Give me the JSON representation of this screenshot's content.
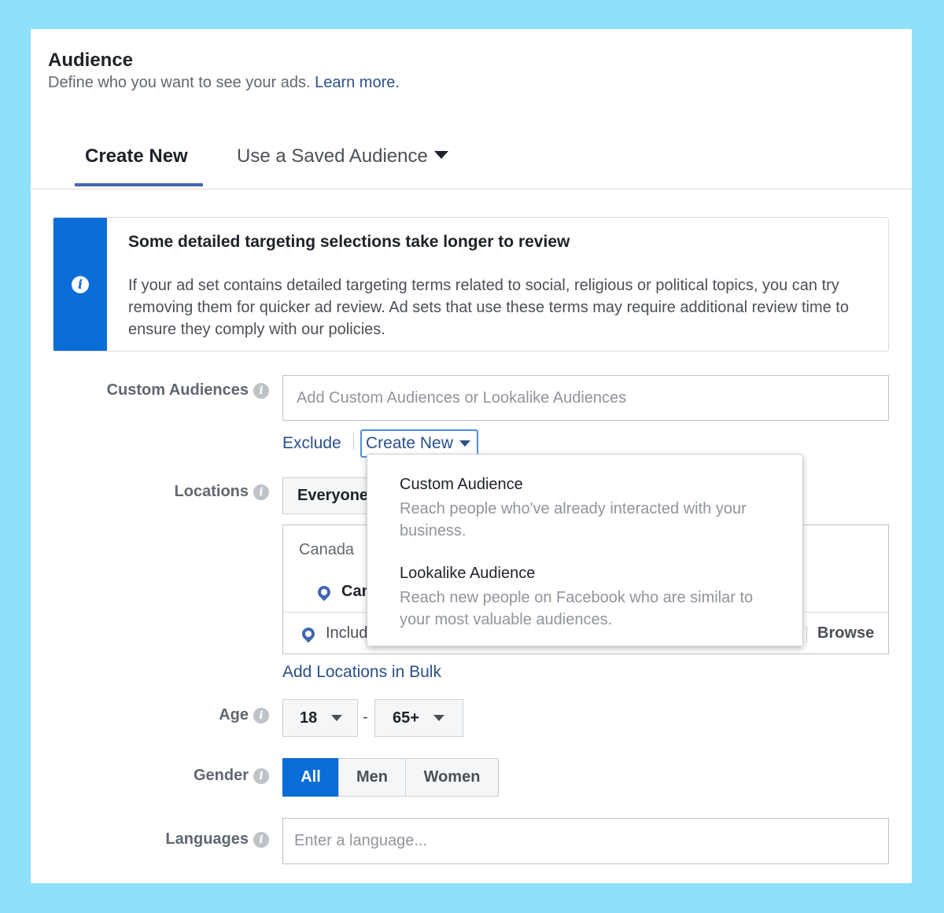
{
  "header": {
    "title": "Audience",
    "subtitle": "Define who you want to see your ads.",
    "learn_more": "Learn more."
  },
  "tabs": {
    "create_new": "Create New",
    "saved_audience": "Use a Saved Audience"
  },
  "notice": {
    "title": "Some detailed targeting selections take longer to review",
    "body": "If your ad set contains detailed targeting terms related to social, religious or political topics, you can try removing them for quicker ad review. Ad sets that use these terms may require additional review time to ensure they comply with our policies."
  },
  "custom_audiences": {
    "label": "Custom Audiences",
    "placeholder": "Add Custom Audiences or Lookalike Audiences",
    "exclude": "Exclude",
    "create_new": "Create New"
  },
  "dropdown": {
    "items": [
      {
        "title": "Custom Audience",
        "description": "Reach people who've already interacted with your business."
      },
      {
        "title": "Lookalike Audience",
        "description": "Reach new people on Facebook who are similar to your most valuable audiences."
      }
    ]
  },
  "locations": {
    "label": "Locations",
    "selector_value": "Everyone",
    "country_header": "Canada",
    "selected_location": "Canada",
    "include_text": "Include",
    "browse": "Browse",
    "add_bulk": "Add Locations in Bulk"
  },
  "age": {
    "label": "Age",
    "min": "18",
    "separator": "-",
    "max": "65+"
  },
  "gender": {
    "label": "Gender",
    "options": [
      "All",
      "Men",
      "Women"
    ],
    "selected": "All"
  },
  "languages": {
    "label": "Languages",
    "placeholder": "Enter a language..."
  },
  "colors": {
    "page_background": "#8fe0f8",
    "accent_blue": "#0a6cd6",
    "link_blue": "#2b4f8c",
    "tab_underline": "#4267b2"
  }
}
